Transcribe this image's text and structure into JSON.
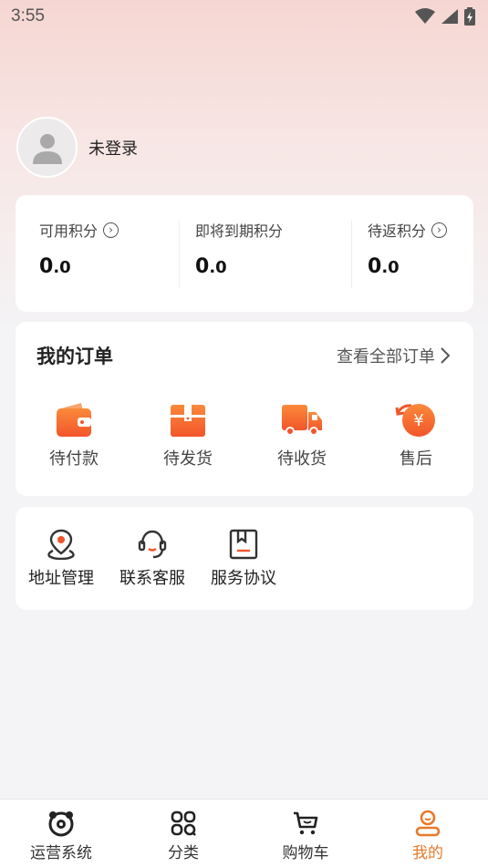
{
  "status_bar": {
    "time": "3:55"
  },
  "profile": {
    "name": "未登录"
  },
  "points": [
    {
      "label": "可用积分",
      "int": "0",
      "dec": ".0",
      "has_info": true
    },
    {
      "label": "即将到期积分",
      "int": "0",
      "dec": ".0",
      "has_info": false
    },
    {
      "label": "待返积分",
      "int": "0",
      "dec": ".0",
      "has_info": true
    }
  ],
  "orders": {
    "title": "我的订单",
    "view_all": "查看全部订单",
    "items": [
      {
        "label": "待付款",
        "icon": "wallet-icon"
      },
      {
        "label": "待发货",
        "icon": "package-icon"
      },
      {
        "label": "待收货",
        "icon": "truck-icon"
      },
      {
        "label": "售后",
        "icon": "yuan-refund-icon"
      }
    ]
  },
  "tools": [
    {
      "label": "地址管理",
      "icon": "location-pin-icon"
    },
    {
      "label": "联系客服",
      "icon": "headset-icon"
    },
    {
      "label": "服务协议",
      "icon": "document-icon"
    }
  ],
  "tabbar": [
    {
      "label": "运营系统",
      "icon": "panda-icon",
      "active": false
    },
    {
      "label": "分类",
      "icon": "grid-icon",
      "active": false
    },
    {
      "label": "购物车",
      "icon": "cart-icon",
      "active": false
    },
    {
      "label": "我的",
      "icon": "user-icon",
      "active": true
    }
  ],
  "colors": {
    "accent": "#e8792a",
    "orange_grad_top": "#fb8a3a",
    "orange_grad_bottom": "#f2552b"
  }
}
